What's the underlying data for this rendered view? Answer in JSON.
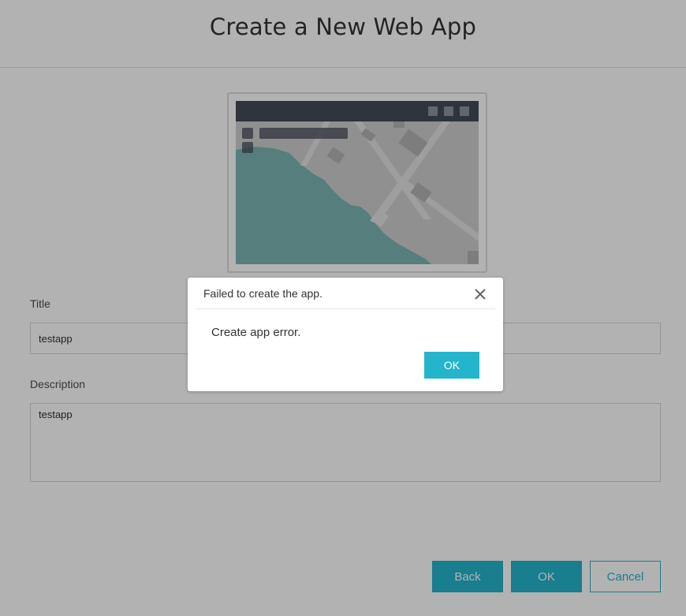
{
  "header": {
    "title": "Create a New Web App"
  },
  "form": {
    "title_label": "Title",
    "title_value": "testapp",
    "description_label": "Description",
    "description_value": "testapp"
  },
  "footer": {
    "back_label": "Back",
    "ok_label": "OK",
    "cancel_label": "Cancel"
  },
  "dialog": {
    "title": "Failed to create the app.",
    "message": "Create app error.",
    "ok_label": "OK",
    "close_icon": "close-icon"
  },
  "colors": {
    "accent": "#24b5cc",
    "overlay": "rgba(0,0,0,0.30)",
    "thumbnail_toolbar": "#434a56",
    "thumbnail_water": "#7ab5b3",
    "thumbnail_land": "#cfcfcf"
  }
}
